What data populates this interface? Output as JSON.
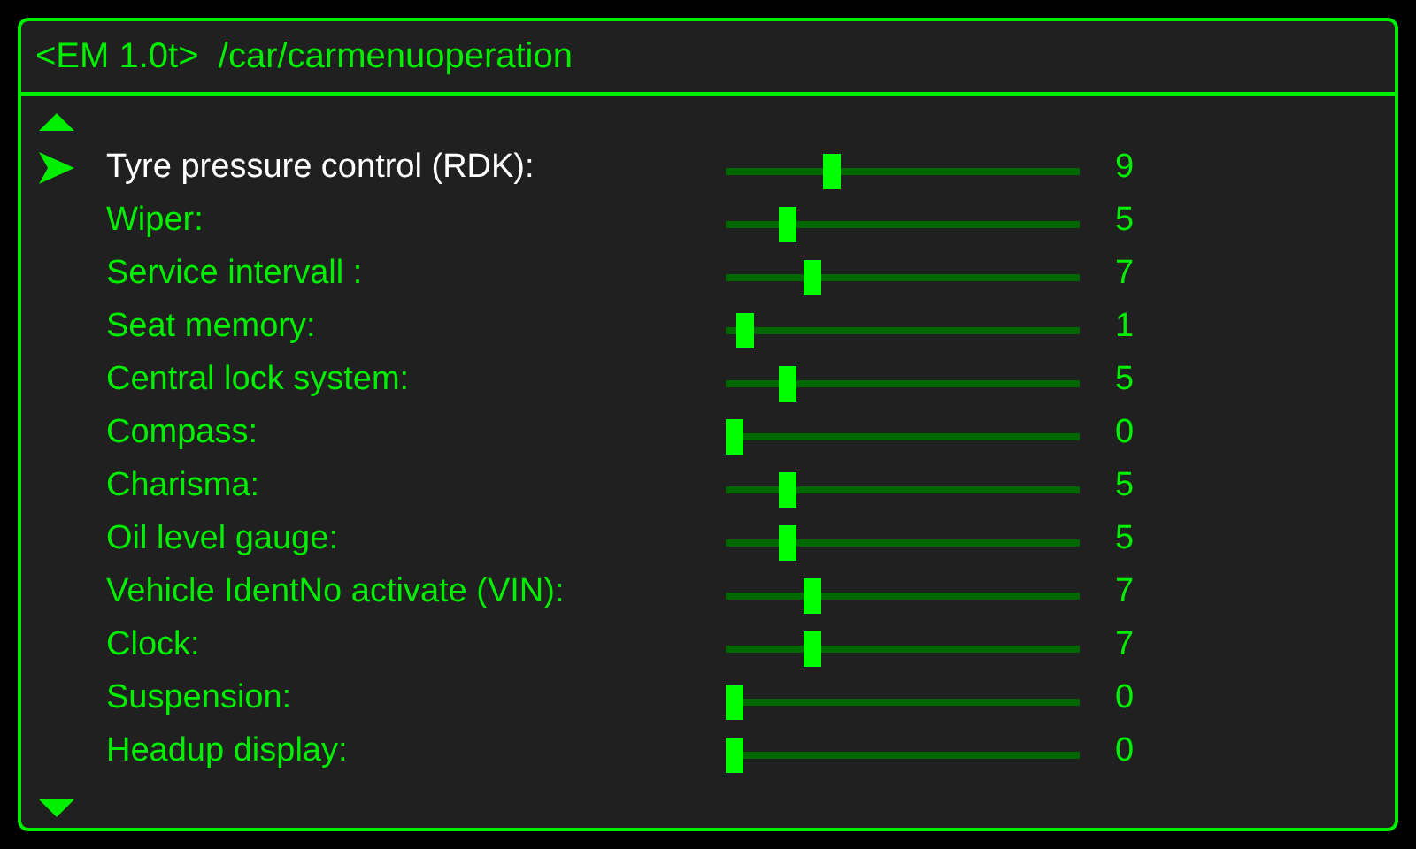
{
  "window": {
    "title": "<EM 1.0t>  /car/carmenuoperation"
  },
  "settings": [
    {
      "label": "Tyre pressure control (RDK):",
      "level": 0.29,
      "reading": "9",
      "selected": true
    },
    {
      "label": "Wiper:",
      "level": 0.16,
      "reading": "5",
      "selected": false
    },
    {
      "label": "Service intervall :",
      "level": 0.23,
      "reading": "7",
      "selected": false
    },
    {
      "label": "Seat memory:",
      "level": 0.03,
      "reading": "1",
      "selected": false
    },
    {
      "label": "Central lock system:",
      "level": 0.16,
      "reading": "5",
      "selected": false
    },
    {
      "label": "Compass:",
      "level": 0,
      "reading": "0",
      "selected": false
    },
    {
      "label": "Charisma:",
      "level": 0.16,
      "reading": "5",
      "selected": false
    },
    {
      "label": "Oil level gauge:",
      "level": 0.16,
      "reading": "5",
      "selected": false
    },
    {
      "label": "Vehicle IdentNo activate (VIN):",
      "level": 0.23,
      "reading": "7",
      "selected": false
    },
    {
      "label": "Clock:",
      "level": 0.23,
      "reading": "7",
      "selected": false
    },
    {
      "label": "Suspension:",
      "level": 0,
      "reading": "0",
      "selected": false
    },
    {
      "label": "Headup display:",
      "level": 0,
      "reading": "0",
      "selected": false
    }
  ]
}
